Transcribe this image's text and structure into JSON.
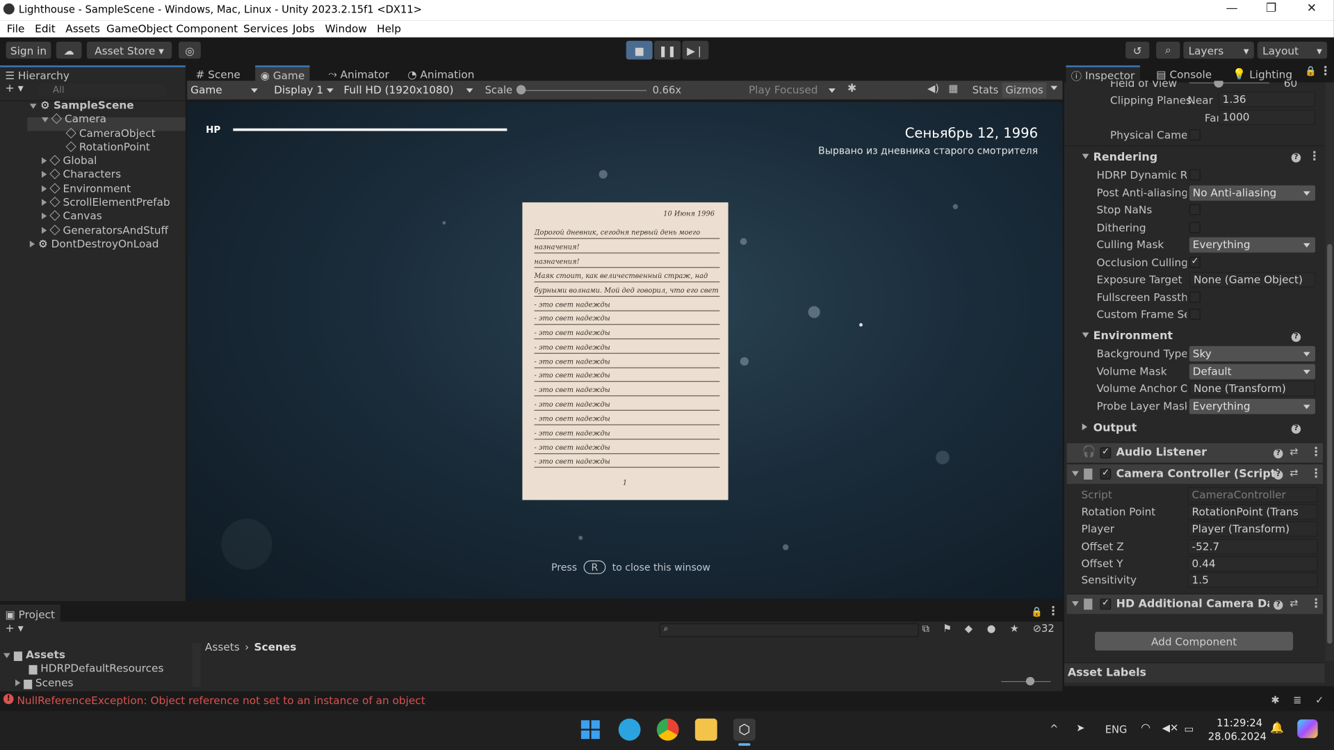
{
  "window": {
    "title": "Lighthouse - SampleScene - Windows, Mac, Linux - Unity 2023.2.15f1 <DX11>",
    "controls": {
      "minimize": "—",
      "restore": "❐",
      "close": "✕"
    }
  },
  "menu": [
    "File",
    "Edit",
    "Assets",
    "GameObject",
    "Component",
    "Services",
    "Jobs",
    "Window",
    "Help"
  ],
  "toolbar": {
    "sign_in": "Sign in",
    "asset_store": "Asset Store",
    "layers": "Layers",
    "layout": "Layout"
  },
  "hierarchy": {
    "tab": "Hierarchy",
    "search_placeholder": "All",
    "items": [
      {
        "label": "SampleScene"
      },
      {
        "label": "Camera"
      },
      {
        "label": "CameraObject"
      },
      {
        "label": "RotationPoint"
      },
      {
        "label": "Global"
      },
      {
        "label": "Characters"
      },
      {
        "label": "Environment"
      },
      {
        "label": "ScrollElementPrefab"
      },
      {
        "label": "Canvas"
      },
      {
        "label": "GeneratorsAndStuff"
      },
      {
        "label": "DontDestroyOnLoad"
      }
    ]
  },
  "center_tabs": [
    "Scene",
    "Game",
    "Animator",
    "Animation"
  ],
  "game_toolbar": {
    "mode": "Game",
    "display": "Display 1",
    "resolution": "Full HD (1920x1080)",
    "scale_label": "Scale",
    "scale_value": "0.66x",
    "scale_fraction": 0.0,
    "play_focused": "Play Focused",
    "stats": "Stats",
    "gizmos": "Gizmos"
  },
  "game_view": {
    "hp_label": "HP",
    "hp_fraction": 1.0,
    "date": "Сеньябрь 12, 1996",
    "subtitle": "Вырвано из дневника старого смотрителя",
    "note_date": "10 Июня 1996",
    "note_lines": [
      "Дорогой дневник, сегодня первый день моего",
      "назначения!",
      "назначения!",
      "Маяк стоит, как величественный страж, над",
      "бурными волнами. Мой дед говорил, что его свет",
      "- это свет надежды",
      "- это свет надежды",
      "- это свет надежды",
      "- это свет надежды",
      "- это свет надежды",
      "- это свет надежды",
      "- это свет надежды",
      "- это свет надежды",
      "- это свет надежды",
      "- это свет надежды",
      "- это свет надежды",
      "- это свет надежды"
    ],
    "page_number": "1",
    "hint_press": "Press",
    "hint_key": "R",
    "hint_rest": "to close this winsow"
  },
  "inspector": {
    "tabs": [
      "Inspector",
      "Console",
      "Lighting"
    ],
    "camera_top": {
      "fov_label": "Field of View",
      "fov_value": "60",
      "clip_label": "Clipping Planes",
      "near_label": "Near",
      "near_value": "1.36",
      "far_label": "Far",
      "far_value": "1000",
      "physical_label": "Physical Camera"
    },
    "rendering": {
      "title": "Rendering",
      "rows": [
        {
          "label": "HDRP Dynamic Re",
          "type": "check",
          "checked": false
        },
        {
          "label": "Post Anti-aliasing",
          "type": "dropdown",
          "value": "No Anti-aliasing"
        },
        {
          "label": "Stop NaNs",
          "type": "check",
          "checked": false
        },
        {
          "label": "Dithering",
          "type": "check",
          "checked": false
        },
        {
          "label": "Culling Mask",
          "type": "dropdown",
          "value": "Everything"
        },
        {
          "label": "Occlusion Culling",
          "type": "check",
          "checked": true
        },
        {
          "label": "Exposure Target",
          "type": "object",
          "value": "None (Game Object)"
        },
        {
          "label": "Fullscreen Passthr",
          "type": "check",
          "checked": false
        },
        {
          "label": "Custom Frame Set",
          "type": "check",
          "checked": false
        }
      ]
    },
    "environment": {
      "title": "Environment",
      "rows": [
        {
          "label": "Background Type",
          "type": "dropdown",
          "value": "Sky"
        },
        {
          "label": "Volume Mask",
          "type": "dropdown",
          "value": "Default"
        },
        {
          "label": "Volume Anchor Ov",
          "type": "object",
          "value": "None (Transform)"
        },
        {
          "label": "Probe Layer Mask",
          "type": "dropdown",
          "value": "Everything"
        }
      ]
    },
    "output_title": "Output",
    "audio_listener": "Audio Listener",
    "camera_controller": {
      "title": "Camera Controller (Script)",
      "rows": [
        {
          "label": "Script",
          "value": "CameraController"
        },
        {
          "label": "Rotation Point",
          "value": "RotationPoint (Trans"
        },
        {
          "label": "Player",
          "value": "Player (Transform)"
        },
        {
          "label": "Offset Z",
          "value": "-52.7"
        },
        {
          "label": "Offset Y",
          "value": "0.44"
        },
        {
          "label": "Sensitivity",
          "value": "1.5"
        }
      ]
    },
    "hd_camera": "HD Additional Camera Data",
    "add_component": "Add Component",
    "asset_labels": "Asset Labels"
  },
  "project": {
    "tab": "Project",
    "tree": [
      "Assets",
      "HDRPDefaultResources",
      "Scenes"
    ],
    "breadcrumb_root": "Assets",
    "breadcrumb_current": "Scenes",
    "hidden_count": "32"
  },
  "status": {
    "error": "NullReferenceException: Object reference not set to an instance of an object"
  },
  "taskbar": {
    "lang": "ENG",
    "time": "11:29:24",
    "date": "28.06.2024"
  },
  "colors": {
    "accent": "#3a79bb",
    "error": "#d9534f",
    "paper": "#ecdfd1"
  }
}
